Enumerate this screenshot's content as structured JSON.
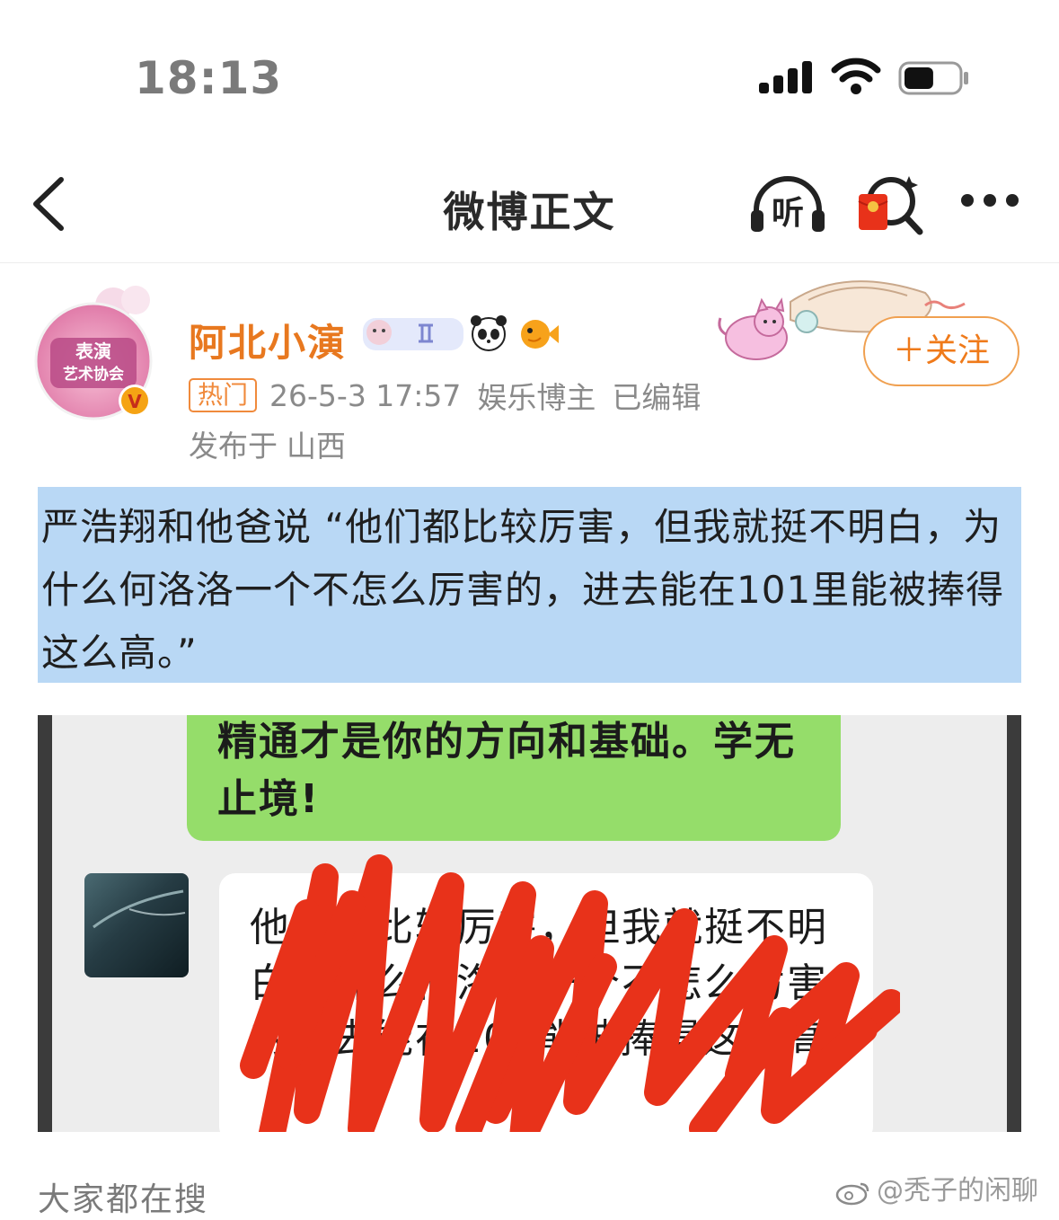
{
  "status_bar": {
    "time": "18:13",
    "battery_level_pct": 55
  },
  "nav": {
    "title": "微博正文",
    "listen_label": "听"
  },
  "post": {
    "username": "阿北小演",
    "avatar_text_line1": "表演",
    "avatar_text_line2": "艺术协会",
    "verified_mark": "V",
    "hot_tag": "热门",
    "timestamp": "26-5-3 17:57",
    "category": "娱乐博主",
    "edited": "已编辑",
    "location_prefix": "发布于",
    "location": "山西",
    "follow_label": "＋关注",
    "text": "严浩翔和他爸说 “他们都比较厉害，但我就挺不明白，为什么何洛洛一个不怎么厉害的，进去能在101里能被捧得这么高。”"
  },
  "embedded_image": {
    "green_bubble_text": "精通才是你的方向和基础。学无止境!",
    "white_bubble_text": "他们都比较厉害，但我就挺不明白为什么何洛洛一个不怎么厉害的进去能在101能被捧得这么高"
  },
  "footer": {
    "trending_label": "大家都在搜",
    "watermark_handle": "@秃子的闲聊"
  },
  "colors": {
    "accent_orange": "#ef7a1a",
    "highlight_blue": "#b9d8f5",
    "chat_green": "#95dd6a",
    "scribble_red": "#e8321a"
  }
}
